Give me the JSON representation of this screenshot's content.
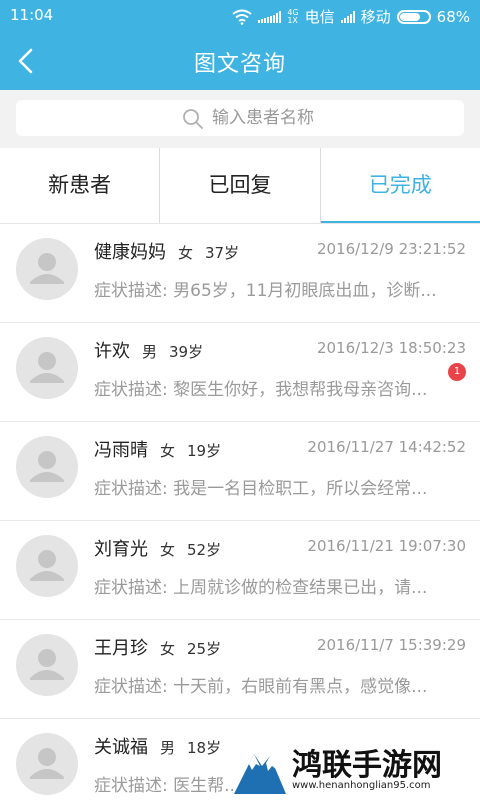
{
  "status_bar": {
    "time": "11:04",
    "net_top": "4G",
    "net_bottom": "1X",
    "carrier1": "电信",
    "carrier2": "移动",
    "battery": "68%"
  },
  "header": {
    "title": "图文咨询",
    "back_icon": "chevron-left-icon"
  },
  "search": {
    "placeholder": "输入患者名称",
    "value": ""
  },
  "tabs": [
    {
      "label": "新患者",
      "active": false
    },
    {
      "label": "已回复",
      "active": false
    },
    {
      "label": "已完成",
      "active": true
    }
  ],
  "patients": [
    {
      "name": "健康妈妈",
      "gender": "女",
      "age": "37岁",
      "date": "2016/12/9 23:21:52",
      "desc": "症状描述: 男65岁，11月初眼底出血，诊断..."
    },
    {
      "name": "许欢",
      "gender": "男",
      "age": "39岁",
      "date": "2016/12/3 18:50:23",
      "desc": "症状描述: 黎医生你好，我想帮我母亲咨询...",
      "badge": "1"
    },
    {
      "name": "冯雨晴",
      "gender": "女",
      "age": "19岁",
      "date": "2016/11/27 14:42:52",
      "desc": "症状描述: 我是一名目检职工，所以会经常..."
    },
    {
      "name": "刘育光",
      "gender": "女",
      "age": "52岁",
      "date": "2016/11/21 19:07:30",
      "desc": "症状描述: 上周就诊做的检查结果已出，请..."
    },
    {
      "name": "王月珍",
      "gender": "女",
      "age": "25岁",
      "date": "2016/11/7 15:39:29",
      "desc": "症状描述: 十天前，右眼前有黑点，感觉像..."
    },
    {
      "name": "关诚福",
      "gender": "男",
      "age": "18岁",
      "date": "",
      "desc": "症状描述: 医生帮..."
    }
  ],
  "watermark": {
    "text": "鸿联手游网",
    "url": "www.henanhonglian95.com"
  },
  "colors": {
    "primary": "#3fb4e3",
    "badge": "#e8444a"
  }
}
